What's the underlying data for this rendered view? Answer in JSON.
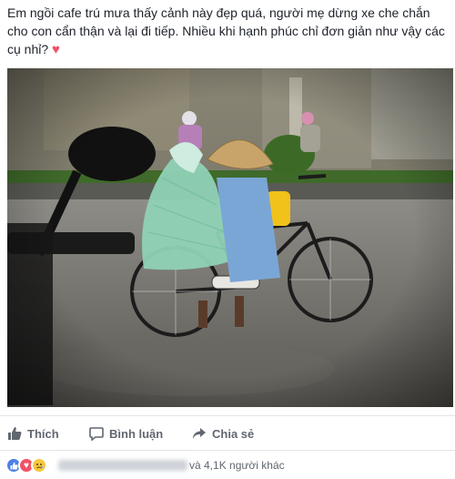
{
  "post": {
    "text": "Em ngồi cafe trú mưa thấy cảnh này đẹp quá, người mẹ dừng xe che chắn cho con cẩn thận và lại đi tiếp. Nhiều khi hạnh phúc chỉ đơn giản như vậy các cụ nhỉ?"
  },
  "actions": {
    "like_label": "Thích",
    "comment_label": "Bình luận",
    "share_label": "Chia sẻ",
    "like_icon": "thumbs-up-icon",
    "comment_icon": "comment-icon",
    "share_icon": "share-arrow-icon"
  },
  "reactions": {
    "icons": [
      "like",
      "love",
      "sad"
    ],
    "summary": "và 4,1K người khác"
  },
  "colors": {
    "text": "#1d2129",
    "muted": "#616770",
    "like_blue": "#4e7fe6",
    "love_red": "#f25268",
    "sad_yellow": "#f7c841"
  }
}
